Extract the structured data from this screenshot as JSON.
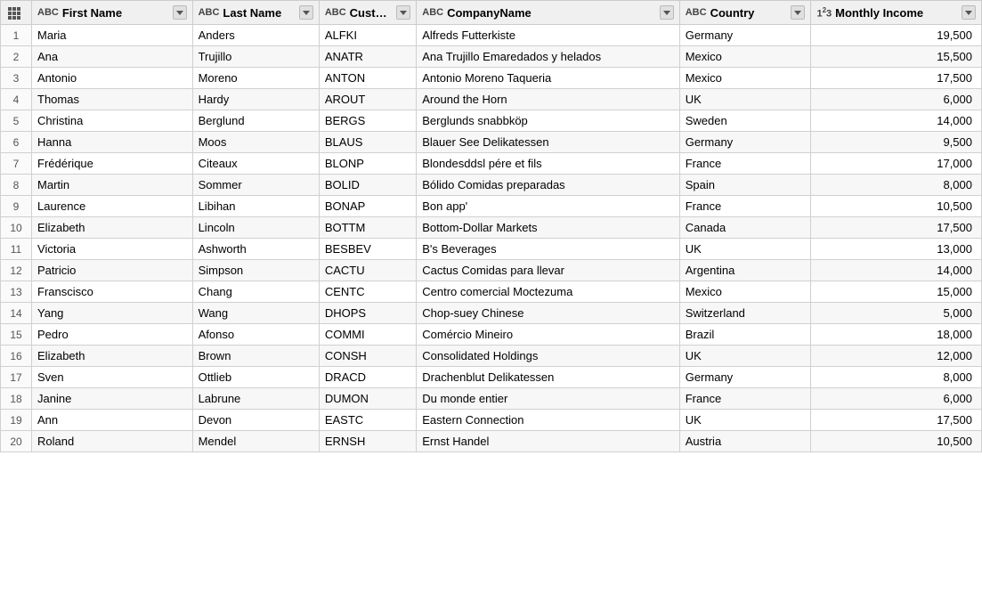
{
  "columns": [
    {
      "id": "num",
      "label": "#",
      "icon": "grid",
      "type": "num",
      "filterable": false
    },
    {
      "id": "fn",
      "label": "First Name",
      "icon": "abc",
      "type": "text",
      "filterable": true
    },
    {
      "id": "ln",
      "label": "Last Name",
      "icon": "abc",
      "type": "text",
      "filterable": true
    },
    {
      "id": "cid",
      "label": "CustomerID",
      "icon": "abc",
      "type": "text",
      "filterable": true
    },
    {
      "id": "cn",
      "label": "CompanyName",
      "icon": "abc",
      "type": "text",
      "filterable": true
    },
    {
      "id": "co",
      "label": "Country",
      "icon": "abc",
      "type": "text",
      "filterable": true
    },
    {
      "id": "mi",
      "label": "Monthly Income",
      "icon": "123",
      "type": "number",
      "filterable": true
    }
  ],
  "rows": [
    {
      "num": 1,
      "fn": "Maria",
      "ln": "Anders",
      "cid": "ALFKI",
      "cn": "Alfreds Futterkiste",
      "co": "Germany",
      "mi": 19500
    },
    {
      "num": 2,
      "fn": "Ana",
      "ln": "Trujillo",
      "cid": "ANATR",
      "cn": "Ana Trujillo Emaredados y helados",
      "co": "Mexico",
      "mi": 15500
    },
    {
      "num": 3,
      "fn": "Antonio",
      "ln": "Moreno",
      "cid": "ANTON",
      "cn": "Antonio Moreno Taqueria",
      "co": "Mexico",
      "mi": 17500
    },
    {
      "num": 4,
      "fn": "Thomas",
      "ln": "Hardy",
      "cid": "AROUT",
      "cn": "Around the Horn",
      "co": "UK",
      "mi": 6000
    },
    {
      "num": 5,
      "fn": "Christina",
      "ln": "Berglund",
      "cid": "BERGS",
      "cn": "Berglunds snabbköp",
      "co": "Sweden",
      "mi": 14000
    },
    {
      "num": 6,
      "fn": "Hanna",
      "ln": "Moos",
      "cid": "BLAUS",
      "cn": "Blauer See Delikatessen",
      "co": "Germany",
      "mi": 9500
    },
    {
      "num": 7,
      "fn": "Frédérique",
      "ln": "Citeaux",
      "cid": "BLONP",
      "cn": "Blondesddsl pére et fils",
      "co": "France",
      "mi": 17000
    },
    {
      "num": 8,
      "fn": "Martin",
      "ln": "Sommer",
      "cid": "BOLID",
      "cn": "Bólido Comidas preparadas",
      "co": "Spain",
      "mi": 8000
    },
    {
      "num": 9,
      "fn": "Laurence",
      "ln": "Libihan",
      "cid": "BONAP",
      "cn": "Bon app'",
      "co": "France",
      "mi": 10500
    },
    {
      "num": 10,
      "fn": "Elizabeth",
      "ln": "Lincoln",
      "cid": "BOTTM",
      "cn": "Bottom-Dollar Markets",
      "co": "Canada",
      "mi": 17500
    },
    {
      "num": 11,
      "fn": "Victoria",
      "ln": "Ashworth",
      "cid": "BESBEV",
      "cn": "B's Beverages",
      "co": "UK",
      "mi": 13000
    },
    {
      "num": 12,
      "fn": "Patricio",
      "ln": "Simpson",
      "cid": "CACTU",
      "cn": "Cactus Comidas para llevar",
      "co": "Argentina",
      "mi": 14000
    },
    {
      "num": 13,
      "fn": "Franscisco",
      "ln": "Chang",
      "cid": "CENTC",
      "cn": "Centro comercial Moctezuma",
      "co": "Mexico",
      "mi": 15000
    },
    {
      "num": 14,
      "fn": "Yang",
      "ln": "Wang",
      "cid": "DHOPS",
      "cn": "Chop-suey Chinese",
      "co": "Switzerland",
      "mi": 5000
    },
    {
      "num": 15,
      "fn": "Pedro",
      "ln": "Afonso",
      "cid": "COMMI",
      "cn": "Comércio Mineiro",
      "co": "Brazil",
      "mi": 18000
    },
    {
      "num": 16,
      "fn": "Elizabeth",
      "ln": "Brown",
      "cid": "CONSH",
      "cn": "Consolidated Holdings",
      "co": "UK",
      "mi": 12000
    },
    {
      "num": 17,
      "fn": "Sven",
      "ln": "Ottlieb",
      "cid": "DRACD",
      "cn": "Drachenblut Delikatessen",
      "co": "Germany",
      "mi": 8000
    },
    {
      "num": 18,
      "fn": "Janine",
      "ln": "Labrune",
      "cid": "DUMON",
      "cn": "Du monde entier",
      "co": "France",
      "mi": 6000
    },
    {
      "num": 19,
      "fn": "Ann",
      "ln": "Devon",
      "cid": "EASTC",
      "cn": "Eastern Connection",
      "co": "UK",
      "mi": 17500
    },
    {
      "num": 20,
      "fn": "Roland",
      "ln": "Mendel",
      "cid": "ERNSH",
      "cn": "Ernst Handel",
      "co": "Austria",
      "mi": 10500
    }
  ]
}
